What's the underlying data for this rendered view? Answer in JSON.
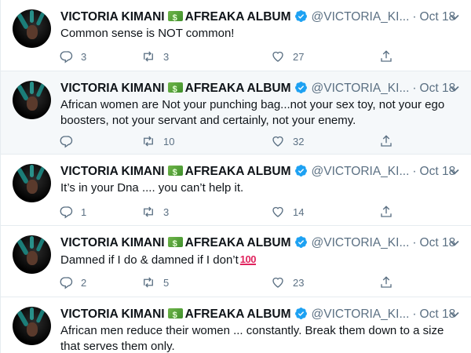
{
  "tweets": [
    {
      "name": "VICTORIA KIMANI",
      "album": "AFREAKA ALBUM",
      "handle": "@VICTORIA_KI...",
      "date": "Oct 18",
      "text": "Common sense is NOT common!",
      "replies": "3",
      "retweets": "3",
      "likes": "27"
    },
    {
      "name": "VICTORIA KIMANI",
      "album": "AFREAKA ALBUM",
      "handle": "@VICTORIA_KI...",
      "date": "Oct 18",
      "text": "African women are Not your punching bag...not your sex toy, not your ego boosters, not your servant and certainly, not your enemy.",
      "replies": "",
      "retweets": "10",
      "likes": "32"
    },
    {
      "name": "VICTORIA KIMANI",
      "album": "AFREAKA ALBUM",
      "handle": "@VICTORIA_KI...",
      "date": "Oct 18",
      "text": "It’s in your Dna .... you can’t help it.",
      "replies": "1",
      "retweets": "3",
      "likes": "14"
    },
    {
      "name": "VICTORIA KIMANI",
      "album": "AFREAKA ALBUM",
      "handle": "@VICTORIA_KI...",
      "date": "Oct 18",
      "text": "Damned if I do & damned if I don’t",
      "emoji": "100",
      "replies": "2",
      "retweets": "5",
      "likes": "23"
    },
    {
      "name": "VICTORIA KIMANI",
      "album": "AFREAKA ALBUM",
      "handle": "@VICTORIA_KI...",
      "date": "Oct 18",
      "text": "African men reduce their women ... constantly.  Break them down to a size that serves them only."
    }
  ],
  "separator": "·",
  "icons": {
    "avatar": "profile-photo",
    "money": "money-with-wings-emoji",
    "verified": "verified-badge-icon",
    "more": "chevron-down-icon",
    "reply": "reply-icon",
    "retweet": "retweet-icon",
    "like": "heart-icon",
    "share": "share-icon",
    "hundred": "hundred-points-emoji"
  },
  "colors": {
    "accent": "#1da1f2",
    "secondary_text": "#5b7083",
    "hover_bg": "#f5f8fa",
    "border": "#e6ecf0"
  }
}
